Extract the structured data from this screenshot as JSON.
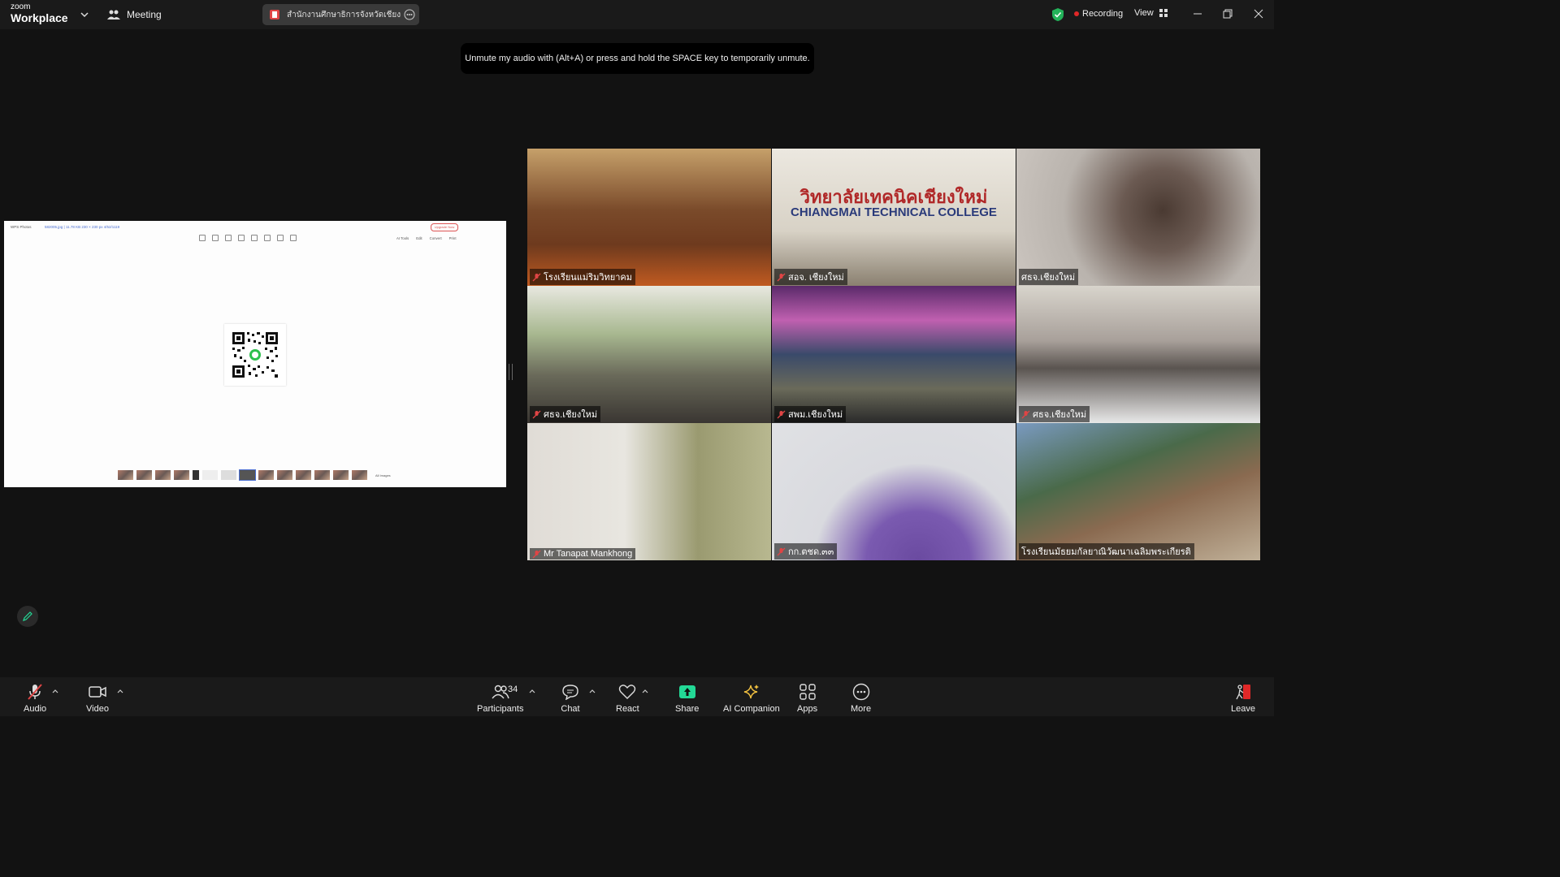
{
  "titlebar": {
    "logo_top": "zoom",
    "logo_bottom": "Workplace",
    "meeting_label": "Meeting",
    "share_title": "สำนักงานศึกษาธิการจังหวัดเชียงใหม่'s s",
    "recording_label": "Recording",
    "view_label": "View"
  },
  "tooltip": "Unmute my audio with (Alt+A) or press and hold the SPACE key to temporarily unmute.",
  "shared_screen": {
    "app_name": "WPS Photos",
    "file_info": "582005.jpg  |  11.78 KB  230 × 230 px  4/52/1119",
    "upgrade_label": "Upgrade Now",
    "right_tools": [
      "AI Tools",
      "Edit",
      "Convert",
      "Print"
    ],
    "all_images_label": "All Images"
  },
  "tiles": [
    {
      "name": "โรงเรียนแม่ริมวิทยาคม",
      "bg": "#7a4a2a"
    },
    {
      "name": "สอจ. เชียงใหม่",
      "bg": "#c9c4b8"
    },
    {
      "name": "ศธจ.เชียงใหม่",
      "bg": "#b9b3ad"
    },
    {
      "name": "ศธจ.เชียงใหม่",
      "bg": "#8f8b72"
    },
    {
      "name": "สพม.เชียงใหม่",
      "bg": "#3b3a55"
    },
    {
      "name": "ศธจ.เชียงใหม่",
      "bg": "#b8b4ae"
    },
    {
      "name": "Mr Tanapat Mankhong",
      "bg": "#d8d6d0"
    },
    {
      "name": "กก.ตชด.๓๓",
      "bg": "#d9dadf"
    },
    {
      "name": "โรงเรียนมัธยมกัลยาณิวัฒนาเฉลิมพระเกียรติ",
      "bg": "#6b7a6a"
    }
  ],
  "tile_label_college_th": "วิทยาลัยเทคนิคเชียงใหม่",
  "tile_label_college_en": "CHIANGMAI TECHNICAL COLLEGE",
  "toolbar": {
    "audio": "Audio",
    "video": "Video",
    "participants": "Participants",
    "participants_count": "34",
    "chat": "Chat",
    "react": "React",
    "share": "Share",
    "ai_companion": "AI Companion",
    "apps": "Apps",
    "more": "More",
    "leave": "Leave"
  },
  "colors": {
    "share_green": "#23d996",
    "leave_red": "#e02828",
    "recording_red": "#e02828"
  }
}
